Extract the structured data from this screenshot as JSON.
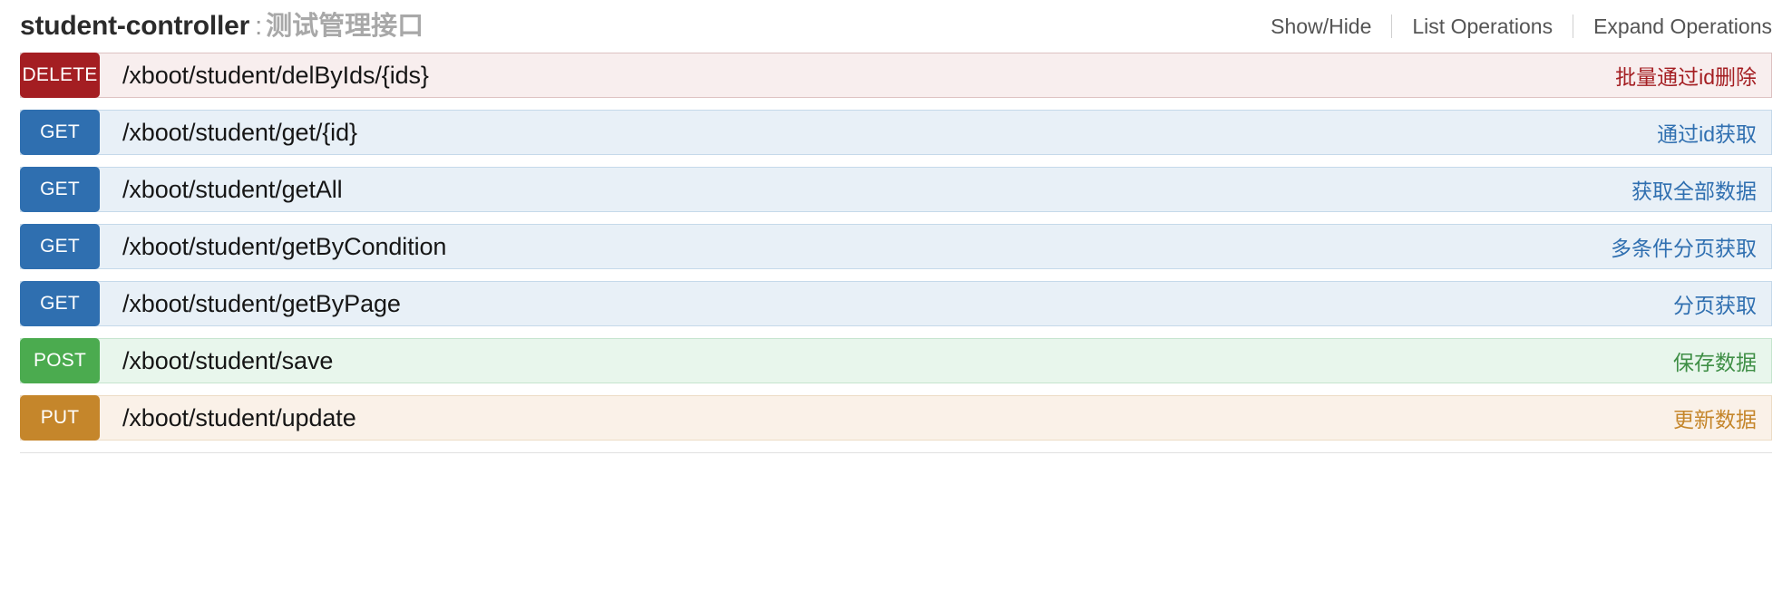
{
  "header": {
    "controller_name": "student-controller",
    "separator": ":",
    "controller_description": "测试管理接口",
    "options": [
      {
        "label": "Show/Hide"
      },
      {
        "label": "List Operations"
      },
      {
        "label": "Expand Operations"
      }
    ]
  },
  "colors": {
    "delete_badge": "#a41e22",
    "delete_bg": "#f8eeee",
    "get_badge": "#2f6fb0",
    "get_bg": "#e8f0f7",
    "post_badge": "#4bab4f",
    "post_bg": "#e8f6ec",
    "put_badge": "#c5862b",
    "put_bg": "#faf1e8",
    "title": "#2b2b2b",
    "title_desc": "#a8a8a8"
  },
  "operations": [
    {
      "method": "DELETE",
      "path": "/xboot/student/delByIds/{ids}",
      "summary": "批量通过id删除"
    },
    {
      "method": "GET",
      "path": "/xboot/student/get/{id}",
      "summary": "通过id获取"
    },
    {
      "method": "GET",
      "path": "/xboot/student/getAll",
      "summary": "获取全部数据"
    },
    {
      "method": "GET",
      "path": "/xboot/student/getByCondition",
      "summary": "多条件分页获取"
    },
    {
      "method": "GET",
      "path": "/xboot/student/getByPage",
      "summary": "分页获取"
    },
    {
      "method": "POST",
      "path": "/xboot/student/save",
      "summary": "保存数据"
    },
    {
      "method": "PUT",
      "path": "/xboot/student/update",
      "summary": "更新数据"
    }
  ]
}
